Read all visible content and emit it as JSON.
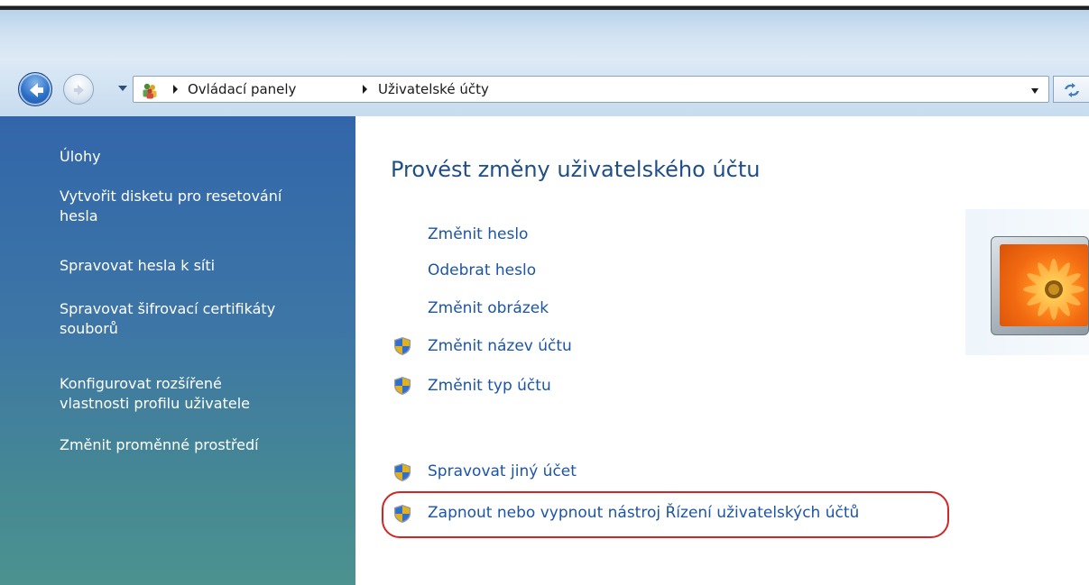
{
  "addressbar": {
    "crumbs": [
      "Ovládací panely",
      "Uživatelské účty"
    ]
  },
  "sidebar": {
    "heading": "Úlohy",
    "items": [
      {
        "line1": "Vytvořit disketu pro resetování",
        "line2": "hesla"
      },
      {
        "line1": "Spravovat hesla k síti",
        "line2": ""
      },
      {
        "line1": "Spravovat šifrovací certifikáty",
        "line2": "souborů"
      },
      {
        "line1": "Konfigurovat rozšířené",
        "line2": "vlastnosti profilu uživatele"
      },
      {
        "line1": "Změnit proměnné prostředí",
        "line2": ""
      }
    ]
  },
  "main": {
    "title": "Provést změny uživatelského účtu",
    "tasks": [
      {
        "label": "Změnit heslo",
        "shield": false
      },
      {
        "label": "Odebrat heslo",
        "shield": false
      },
      {
        "label": "Změnit obrázek",
        "shield": false
      },
      {
        "label": "Změnit název účtu",
        "shield": true
      },
      {
        "label": "Změnit typ účtu",
        "shield": true
      }
    ],
    "other_tasks": [
      {
        "label": "Spravovat jiný účet",
        "shield": true
      },
      {
        "label": "Zapnout nebo vypnout nástroj Řízení uživatelských účtů",
        "shield": true,
        "highlighted": true
      }
    ]
  },
  "colors": {
    "link": "#1c55a6",
    "title": "#1f4f86",
    "sidebar_top": "#3266aa",
    "sidebar_bottom": "#4b9290",
    "highlight": "#d42525"
  },
  "icons": {
    "back": "back-arrow-icon",
    "forward": "forward-arrow-icon",
    "address": "users-icon",
    "shield": "uac-shield-icon",
    "refresh": "refresh-icon"
  }
}
